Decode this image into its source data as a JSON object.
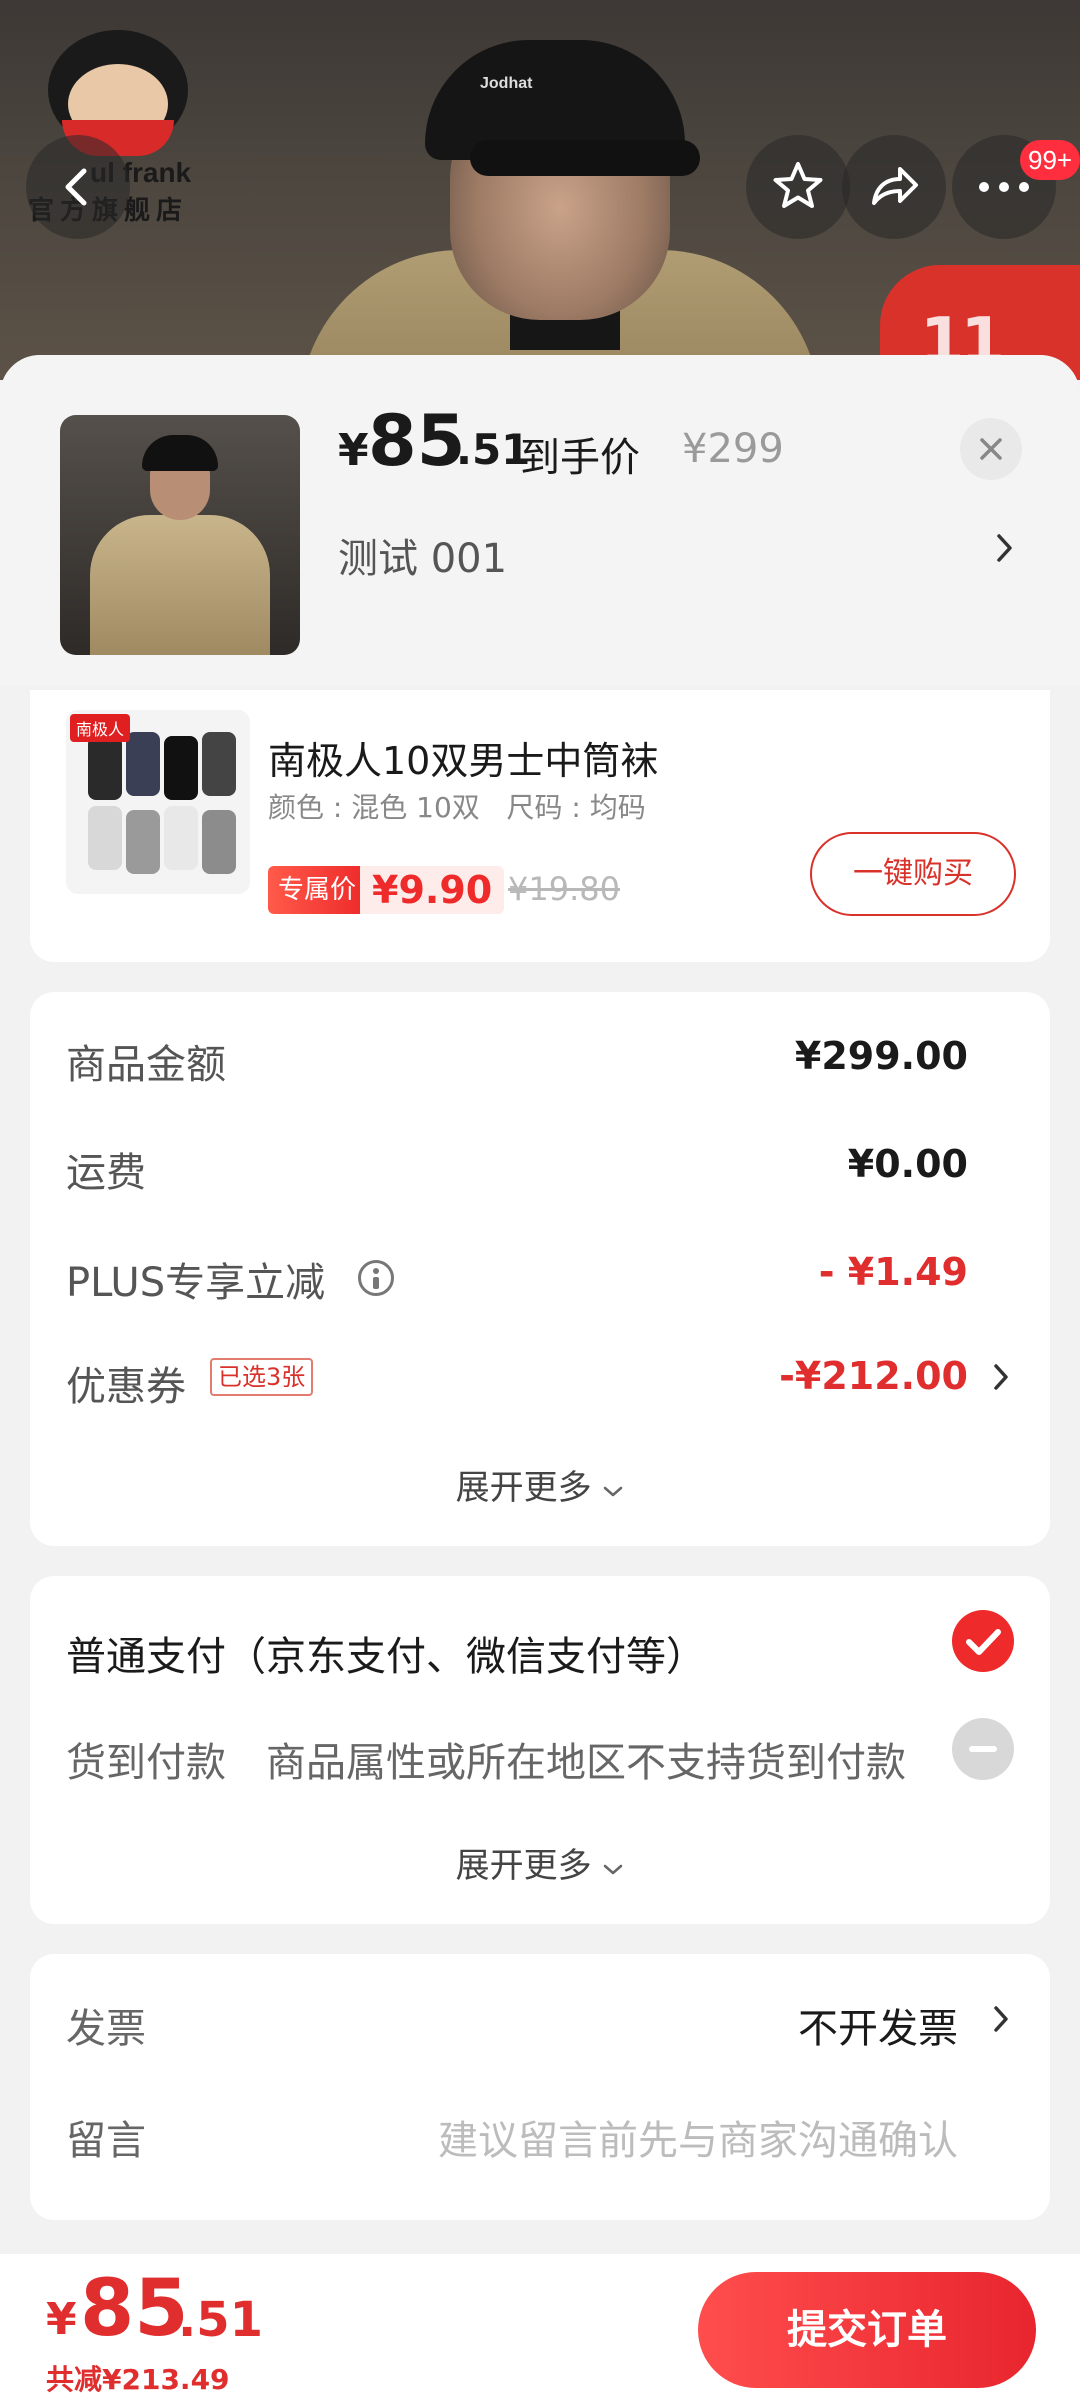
{
  "store": {
    "logo_text": "ul frank",
    "logo_sub": "官方旗舰店"
  },
  "hero": {
    "cap_text": "Jodhat",
    "badge_text": "11",
    "more_badge": "99+"
  },
  "product": {
    "price_yen": "¥",
    "price_int": "85",
    "price_dec": ".51",
    "price_label": "到手价",
    "orig_price": "¥299",
    "spec": "测试  001"
  },
  "upsell": {
    "brand_tag": "南极人",
    "title": "南极人10双男士中筒袜",
    "spec": "颜色 : 混色 10双   尺码 : 均码",
    "tag": "专属价",
    "price": "¥9.90",
    "orig_price": "¥19.80",
    "button": "一键购买"
  },
  "amounts": {
    "rows": [
      {
        "label": "商品金额",
        "value": "¥299.00"
      },
      {
        "label": "运费",
        "value": "¥0.00"
      },
      {
        "label": "PLUS专享立减",
        "value": "- ¥1.49"
      },
      {
        "label": "优惠券",
        "value": "-¥212.00"
      }
    ],
    "coupon_badge": "已选3张",
    "expand": "展开更多"
  },
  "payment": {
    "normal": "普通支付（京东支付、微信支付等）",
    "cod_label": "货到付款",
    "cod_note": "商品属性或所在地区不支持货到付款",
    "expand": "展开更多"
  },
  "invoice": {
    "label": "发票",
    "value": "不开发票",
    "message_label": "留言",
    "message_placeholder": "建议留言前先与商家沟通确认"
  },
  "footer": {
    "yen": "¥",
    "int": "85",
    "dec": ".51",
    "saved": "共减¥213.49",
    "submit": "提交订单"
  },
  "colors": {
    "accent": "#e02d2d",
    "button_gradient_start": "#ff4d4d",
    "button_gradient_end": "#e8252e"
  }
}
